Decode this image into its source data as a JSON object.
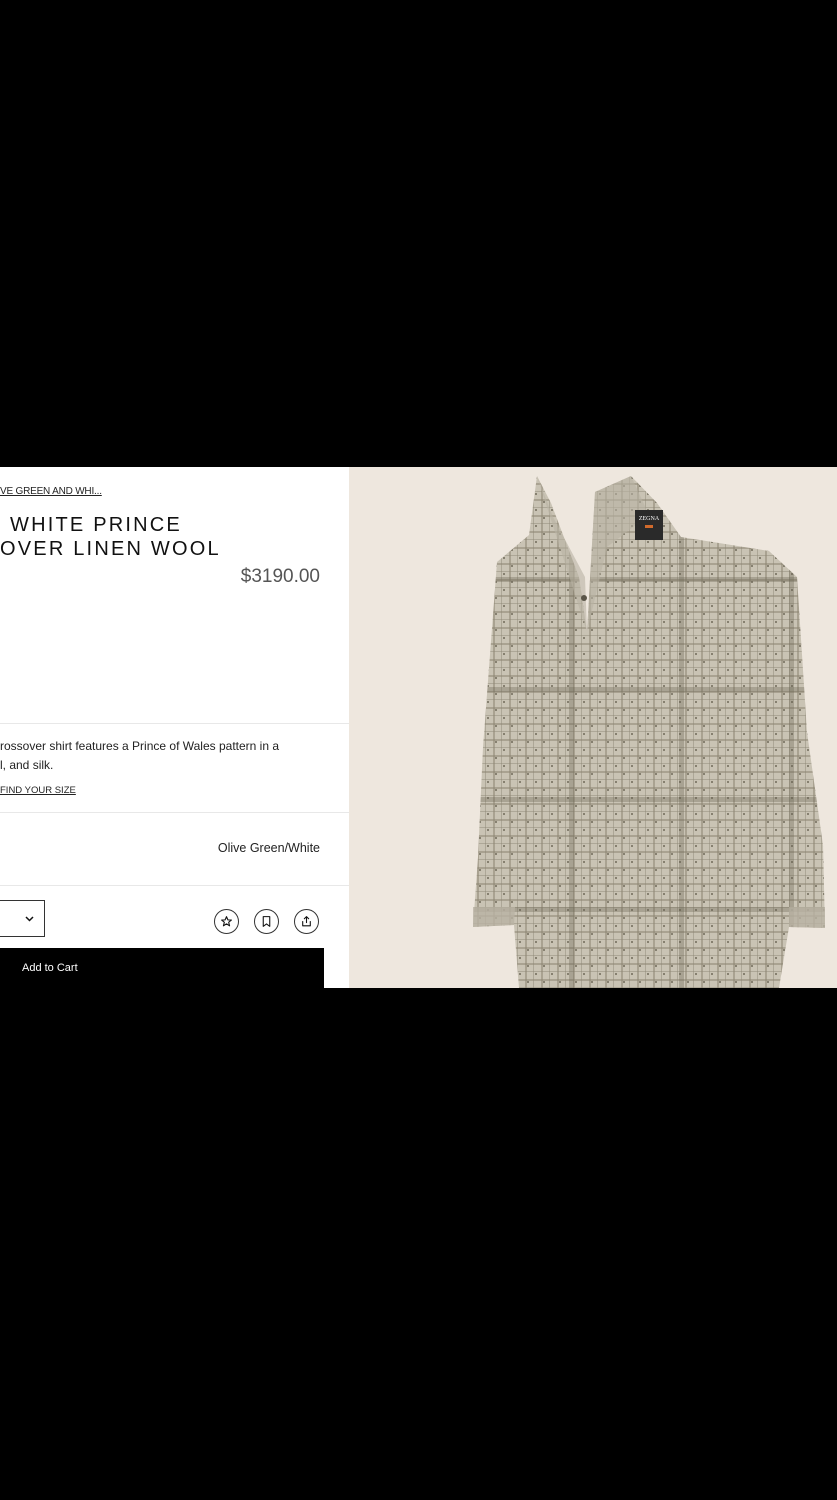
{
  "product": {
    "breadcrumb": "VE GREEN AND WHI...",
    "title_line1": "WHITE PRINCE",
    "title_line2": "OVER LINEN WOOL",
    "price": "$3190.00",
    "description_line1": "rossover shirt features a Prince of Wales pattern in a",
    "description_line2": "l, and silk.",
    "find_size_link": "FIND YOUR SIZE",
    "color_value": "Olive Green/White",
    "add_to_cart_label": "Add to Cart"
  },
  "actions": {
    "icons": [
      "chevron-down-icon",
      "star-icon",
      "bookmark-icon",
      "share-icon"
    ]
  },
  "image": {
    "label_text": "ZEGNA",
    "colors": {
      "background": "#eee7de",
      "shirt": "#c9c3b4",
      "check_dark": "#6a6453",
      "label": "#2a2a2a"
    }
  }
}
